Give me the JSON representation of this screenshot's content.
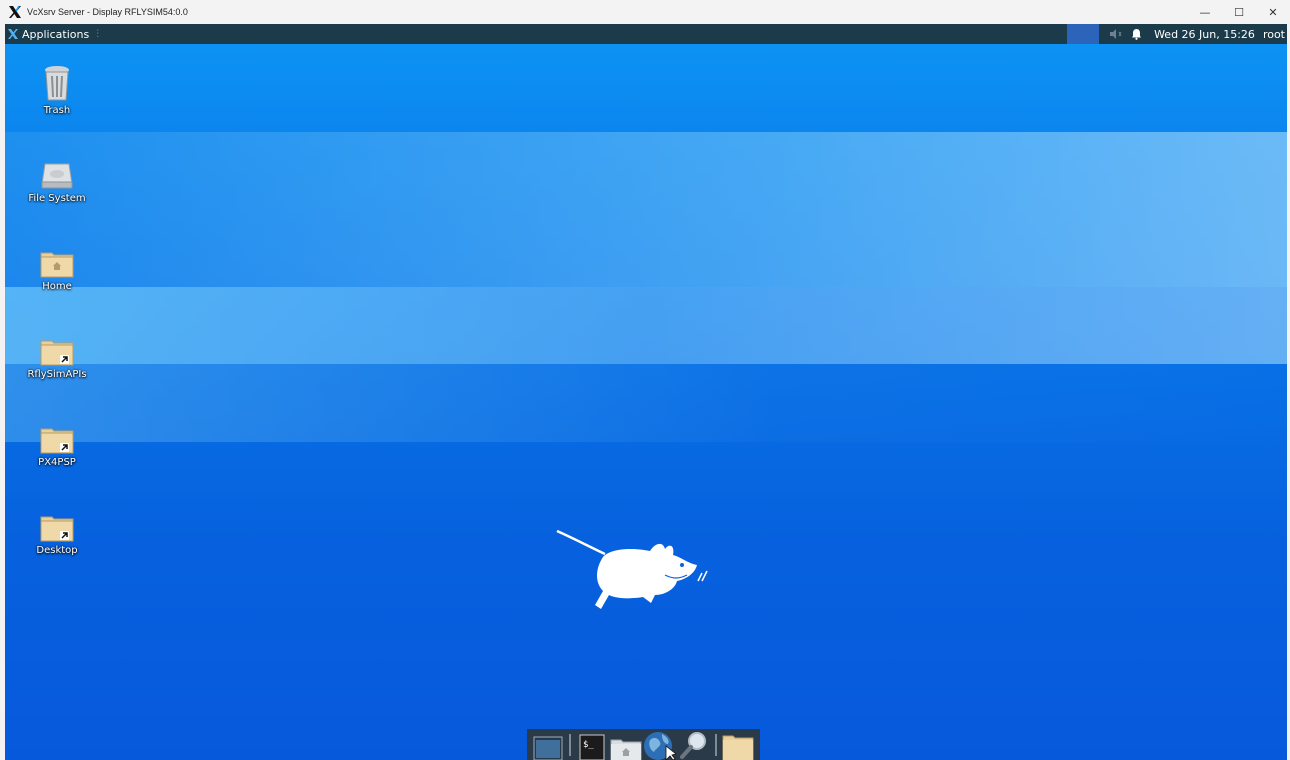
{
  "window": {
    "title": "VcXsrv Server - Display RFLYSIM54:0.0",
    "controls": {
      "minimize": "—",
      "maximize": "☐",
      "close": "✕"
    }
  },
  "panel": {
    "applications_label": "Applications",
    "separator": "⋮",
    "clock": "Wed 26 Jun, 15:26",
    "user": "root"
  },
  "desktop": {
    "icons": [
      {
        "label": "Trash",
        "icon": "trash-icon"
      },
      {
        "label": "File System",
        "icon": "drive-icon"
      },
      {
        "label": "Home",
        "icon": "home-folder-icon"
      },
      {
        "label": "RflySimAPIs",
        "icon": "folder-link-icon"
      },
      {
        "label": "PX4PSP",
        "icon": "folder-link-icon"
      },
      {
        "label": "Desktop",
        "icon": "folder-link-icon"
      }
    ]
  },
  "dock": {
    "items": [
      "show-desktop-icon",
      "terminal-icon",
      "home-folder-icon",
      "web-browser-icon",
      "search-icon",
      "folder-icon"
    ]
  },
  "colors": {
    "panel": "#1b3a4a",
    "desktop_top": "#0a8cf0",
    "desktop_bottom": "#0759dc",
    "workspace": "#2b64b8"
  }
}
